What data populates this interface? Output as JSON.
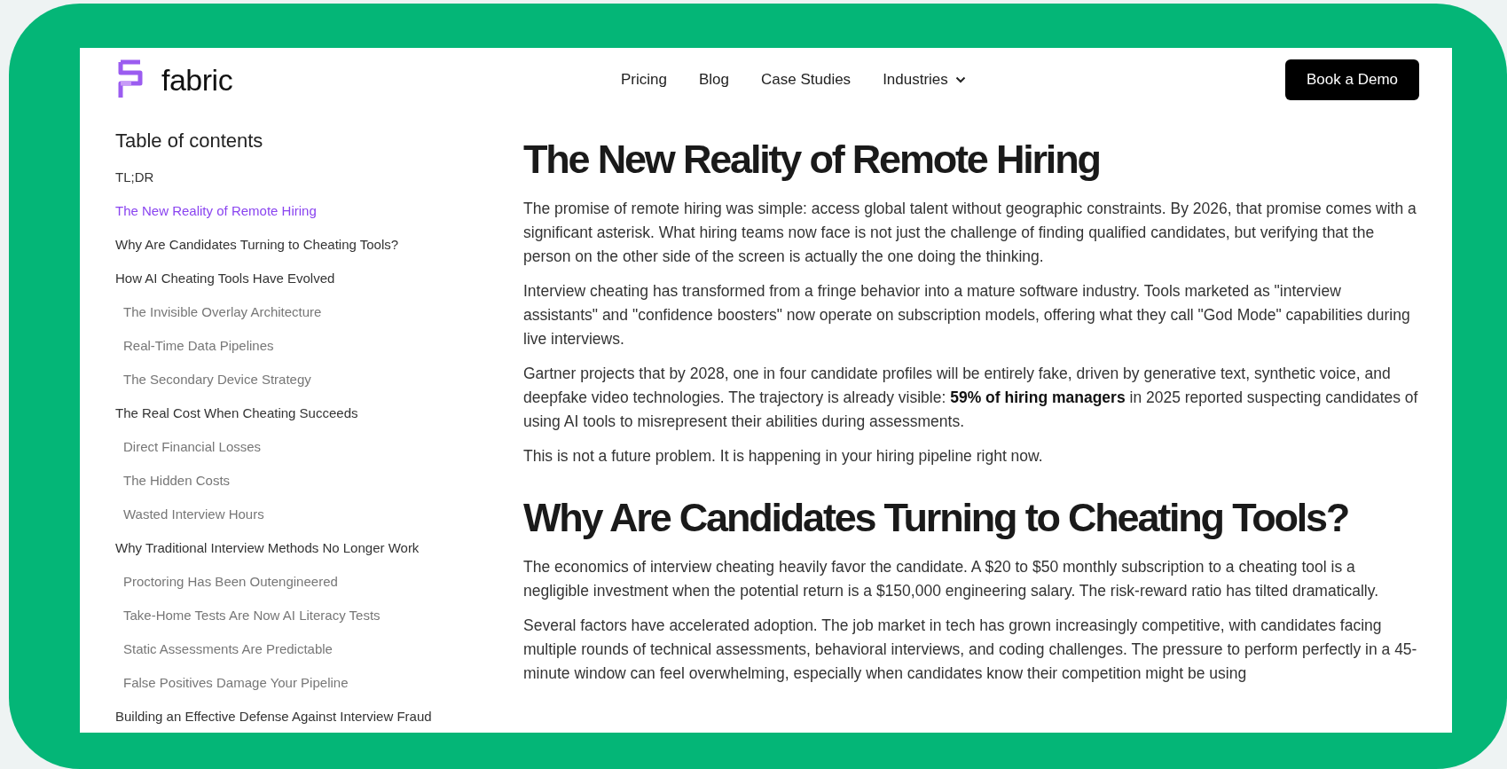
{
  "header": {
    "logo_text": "fabric",
    "nav": [
      {
        "label": "Pricing",
        "dropdown": false
      },
      {
        "label": "Blog",
        "dropdown": false
      },
      {
        "label": "Case Studies",
        "dropdown": false
      },
      {
        "label": "Industries",
        "dropdown": true
      }
    ],
    "cta": "Book a Demo"
  },
  "toc": {
    "title": "Table of contents",
    "items": [
      {
        "label": "TL;DR",
        "selected": false
      },
      {
        "label": "The New Reality of Remote Hiring",
        "selected": true
      },
      {
        "label": "Why Are Candidates Turning to Cheating Tools?",
        "selected": false
      },
      {
        "label": "How AI Cheating Tools Have Evolved",
        "selected": false,
        "children": [
          {
            "label": "The Invisible Overlay Architecture",
            "selected": false
          },
          {
            "label": "Real-Time Data Pipelines",
            "selected": false
          },
          {
            "label": "The Secondary Device Strategy",
            "selected": false
          }
        ]
      },
      {
        "label": "The Real Cost When Cheating Succeeds",
        "selected": false,
        "children": [
          {
            "label": "Direct Financial Losses",
            "selected": false
          },
          {
            "label": "The Hidden Costs",
            "selected": false
          },
          {
            "label": "Wasted Interview Hours",
            "selected": false
          }
        ]
      },
      {
        "label": "Why Traditional Interview Methods No Longer Work",
        "selected": false,
        "children": [
          {
            "label": "Proctoring Has Been Outengineered",
            "selected": false
          },
          {
            "label": "Take-Home Tests Are Now AI Literacy Tests",
            "selected": false
          },
          {
            "label": "Static Assessments Are Predictable",
            "selected": false
          },
          {
            "label": "False Positives Damage Your Pipeline",
            "selected": false
          }
        ]
      },
      {
        "label": "Building an Effective Defense Against Interview Fraud",
        "selected": false
      }
    ]
  },
  "article": [
    {
      "heading": "The New Reality of Remote Hiring",
      "paragraphs": [
        "The promise of remote hiring was simple: access global talent without geographic constraints. By 2026, that promise comes with a significant asterisk. What hiring teams now face is not just the challenge of finding qualified candidates, but verifying that the person on the other side of the screen is actually the one doing the thinking.",
        "Interview cheating has transformed from a fringe behavior into a mature software industry. Tools marketed as \"interview assistants\" and \"confidence boosters\" now operate on subscription models, offering what they call \"God Mode\" capabilities during live interviews.",
        "Gartner projects that by 2028, one in four candidate profiles will be entirely fake, driven by generative text, synthetic voice, and deepfake video technologies. The trajectory is already visible: **59% of hiring managers** in 2025 reported suspecting candidates of using AI tools to misrepresent their abilities during assessments.",
        "This is not a future problem. It is happening in your hiring pipeline right now."
      ]
    },
    {
      "heading": "Why Are Candidates Turning to Cheating Tools?",
      "paragraphs": [
        "The economics of interview cheating heavily favor the candidate. A $20 to $50 monthly subscription to a cheating tool is a negligible investment when the potential return is a $150,000 engineering salary. The risk-reward ratio has tilted dramatically.",
        "Several factors have accelerated adoption. The job market in tech has grown increasingly competitive, with candidates facing multiple rounds of technical assessments, behavioral interviews, and coding challenges. The pressure to perform perfectly in a 45-minute window can feel overwhelming, especially when candidates know their competition might be using"
      ]
    }
  ]
}
